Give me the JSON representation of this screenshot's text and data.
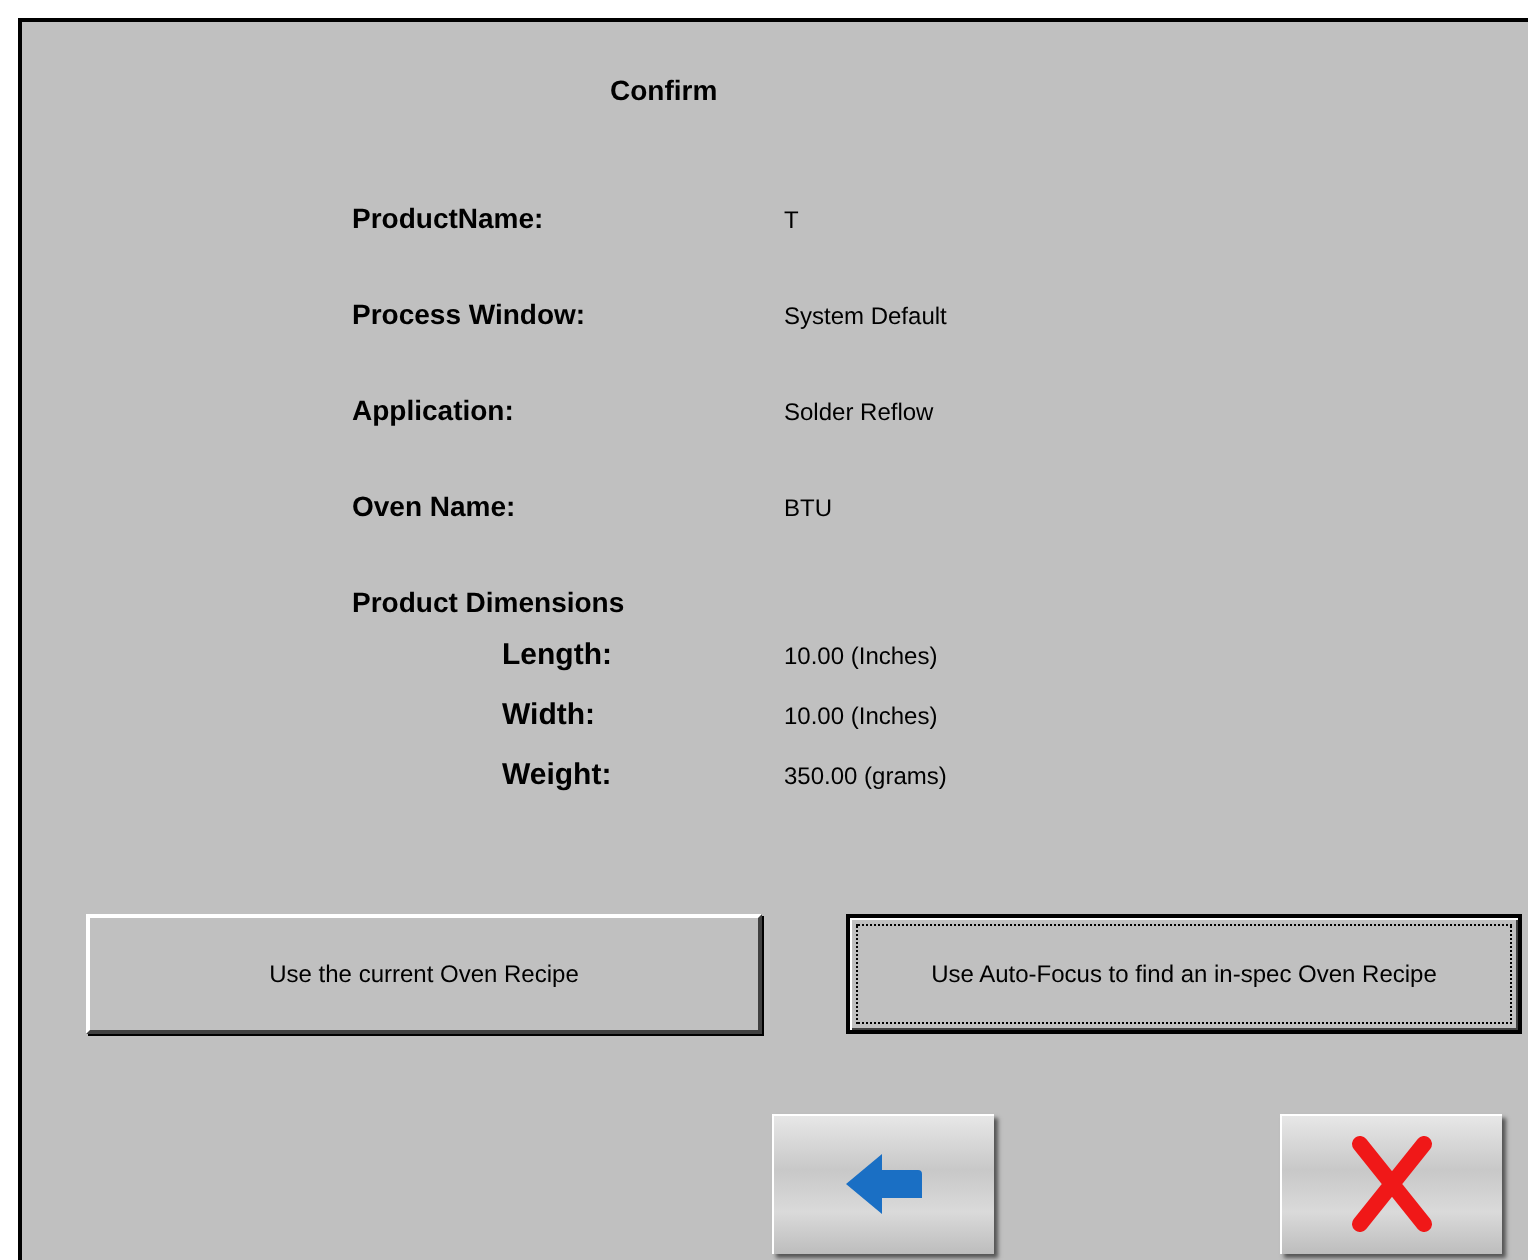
{
  "title": "Confirm",
  "fields": [
    {
      "label": "ProductName:",
      "value": "T"
    },
    {
      "label": "Process Window:",
      "value": "System Default"
    },
    {
      "label": "Application:",
      "value": "Solder Reflow"
    },
    {
      "label": "Oven Name:",
      "value": "BTU"
    }
  ],
  "dimensions": {
    "heading": "Product Dimensions",
    "fields": [
      {
        "label": "Length:",
        "value": "10.00 (Inches)"
      },
      {
        "label": "Width:",
        "value": "10.00 (Inches)"
      },
      {
        "label": "Weight:",
        "value": "350.00 (grams)"
      }
    ]
  },
  "choices": [
    {
      "label": "Use the current Oven Recipe",
      "focused": false
    },
    {
      "label": "Use Auto-Focus to find an in-spec Oven Recipe",
      "focused": true
    }
  ],
  "nav_buttons": [
    {
      "kind": "back"
    },
    {
      "kind": "cancel"
    }
  ]
}
